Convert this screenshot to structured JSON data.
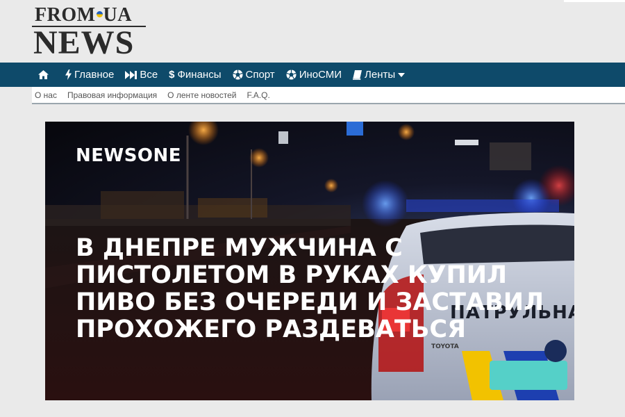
{
  "logo": {
    "top_text_before": "FROM",
    "top_text_after": "UA",
    "bottom_text": "NEWS"
  },
  "nav": {
    "items": [
      {
        "label": "",
        "icon": "home-icon"
      },
      {
        "label": "Главное",
        "icon": "bolt-icon"
      },
      {
        "label": "Все",
        "icon": "fast-forward-icon"
      },
      {
        "label": "Финансы",
        "icon": "dollar-icon"
      },
      {
        "label": "Спорт",
        "icon": "soccer-ball-icon"
      },
      {
        "label": "ИноСМИ",
        "icon": "soccer-ball-icon"
      },
      {
        "label": "Ленты",
        "icon": "book-icon"
      }
    ]
  },
  "subnav": {
    "items": [
      "О нас",
      "Правовая информация",
      "О ленте новостей",
      "F.A.Q."
    ]
  },
  "hero": {
    "brand": "NEWSONE",
    "headline": "В Днепре мужчина с пистолетом в руках купил пиво без очереди и заставил прохожего раздеваться",
    "car_label": "ПАТРУЛЬНА",
    "car_brand": "TOYOTA"
  },
  "colors": {
    "navbar": "#0e4a6a",
    "background": "#eaeaea",
    "subnav": "#ffffff"
  }
}
